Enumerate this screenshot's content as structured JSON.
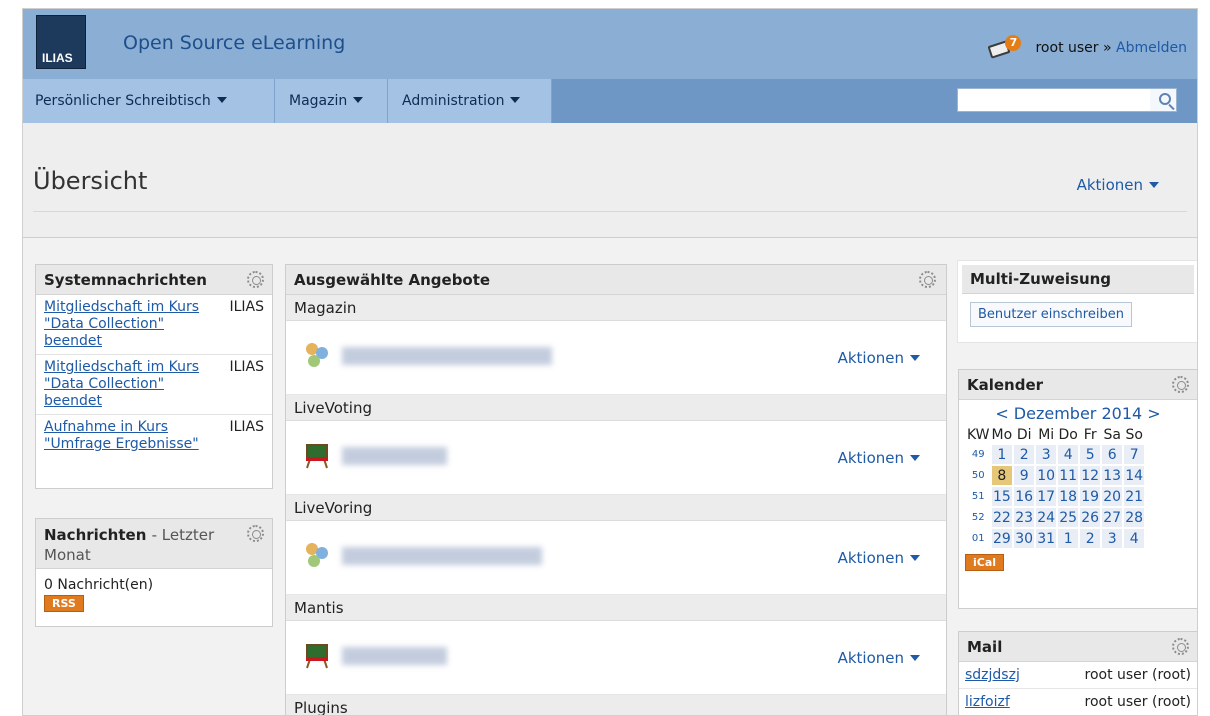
{
  "header": {
    "logo": "ILIAS",
    "site_title": "Open Source eLearning",
    "mail_badge": "7",
    "user_prefix": "root user »",
    "logout": "Abmelden"
  },
  "nav": {
    "items": [
      {
        "label": "Persönlicher Schreibtisch"
      },
      {
        "label": "Magazin"
      },
      {
        "label": "Administration"
      }
    ],
    "search_placeholder": ""
  },
  "page": {
    "title": "Übersicht",
    "actions": "Aktionen"
  },
  "system_messages": {
    "title": "Systemnachrichten",
    "items": [
      {
        "text": "Mitgliedschaft im Kurs \"Data Collection\" beendet",
        "source": "ILIAS"
      },
      {
        "text": "Mitgliedschaft im Kurs \"Data Collection\" beendet",
        "source": "ILIAS"
      },
      {
        "text": "Aufnahme in Kurs \"Umfrage Ergebnisse\"",
        "source": "ILIAS"
      }
    ]
  },
  "messages": {
    "title": "Nachrichten",
    "subtitle": "- Letzter Monat",
    "count": "0 Nachricht(en)",
    "rss": "RSS"
  },
  "selected": {
    "title": "Ausgewählte Angebote",
    "sections": [
      {
        "label": "Magazin",
        "action": "Aktionen"
      },
      {
        "label": "LiveVoting",
        "action": "Aktionen"
      },
      {
        "label": "LiveVoring",
        "action": "Aktionen"
      },
      {
        "label": "Mantis",
        "action": "Aktionen"
      },
      {
        "label": "Plugins"
      }
    ]
  },
  "multi": {
    "title": "Multi-Zuweisung",
    "button": "Benutzer einschreiben"
  },
  "calendar": {
    "title": "Kalender",
    "month": "< Dezember 2014 >",
    "headers": [
      "KW",
      "Mo",
      "Di",
      "Mi",
      "Do",
      "Fr",
      "Sa",
      "So"
    ],
    "weeks": [
      [
        "49",
        "1",
        "2",
        "3",
        "4",
        "5",
        "6",
        "7"
      ],
      [
        "50",
        "8",
        "9",
        "10",
        "11",
        "12",
        "13",
        "14"
      ],
      [
        "51",
        "15",
        "16",
        "17",
        "18",
        "19",
        "20",
        "21"
      ],
      [
        "52",
        "22",
        "23",
        "24",
        "25",
        "26",
        "27",
        "28"
      ],
      [
        "01",
        "29",
        "30",
        "31",
        "1",
        "2",
        "3",
        "4"
      ]
    ],
    "today": "8",
    "ical": "iCal"
  },
  "mail": {
    "title": "Mail",
    "items": [
      {
        "subject": "sdzjdszj",
        "from": "root user (root)"
      },
      {
        "subject": "lizfoizf",
        "from": "root user (root)"
      }
    ]
  }
}
